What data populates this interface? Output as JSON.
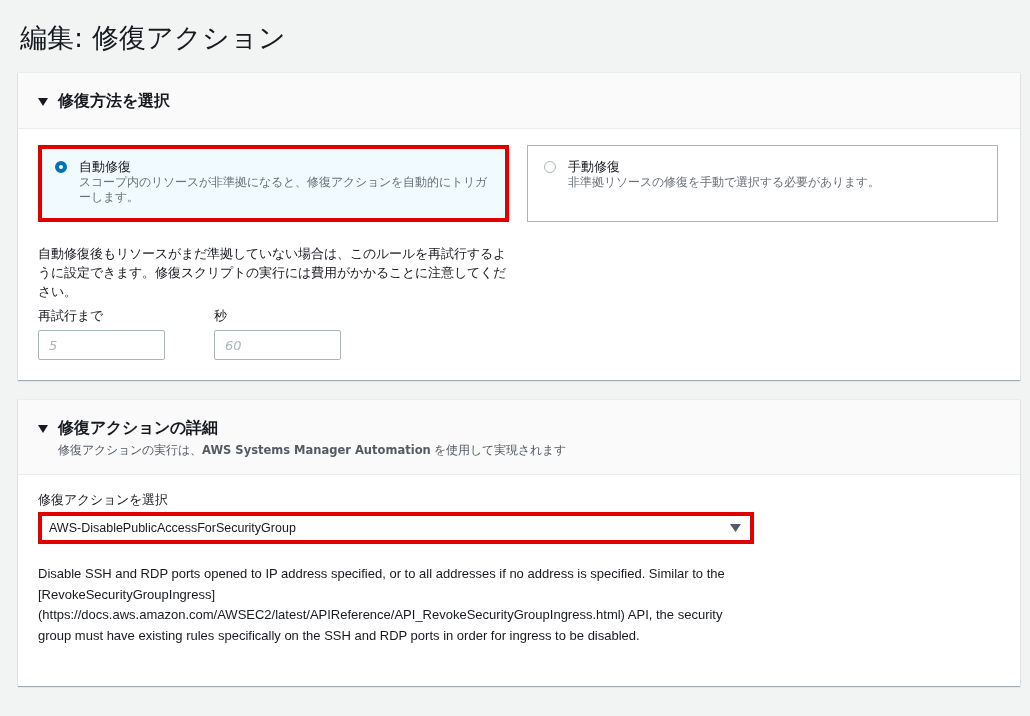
{
  "page_title": "編集: 修復アクション",
  "method_panel": {
    "title": "修復方法を選択",
    "expanded": true,
    "options": [
      {
        "label": "自動修復",
        "description": "スコープ内のリソースが非準拠になると、修復アクションを自動的にトリガーします。",
        "selected": true,
        "highlighted": true
      },
      {
        "label": "手動修復",
        "description": "非準拠リソースの修復を手動で選択する必要があります。",
        "selected": false,
        "highlighted": false
      }
    ],
    "retry_note": "自動修復後もリソースがまだ準拠していない場合は、このルールを再試行するように設定できます。修復スクリプトの実行には費用がかかることに注意してください。",
    "fields": [
      {
        "label": "再試行まで",
        "placeholder": "5"
      },
      {
        "label": "秒",
        "placeholder": "60"
      }
    ]
  },
  "action_panel": {
    "title": "修復アクションの詳細",
    "expanded": true,
    "subtitle": "修復アクションの実行は、**AWS Systems Manager Automation** を使用して実現されます",
    "select_label": "修復アクションを選択",
    "select_value": "AWS-DisablePublicAccessForSecurityGroup",
    "select_highlighted": true,
    "description": "Disable SSH and RDP ports opened to IP address specified, or to all addresses if no address is specified. Similar to the [RevokeSecurityGroupIngress] (https://docs.aws.amazon.com/AWSEC2/latest/APIReference/API_RevokeSecurityGroupIngress.html) API, the security group must have existing rules specifically on the SSH and RDP ports in order for ingress to be disabled."
  }
}
